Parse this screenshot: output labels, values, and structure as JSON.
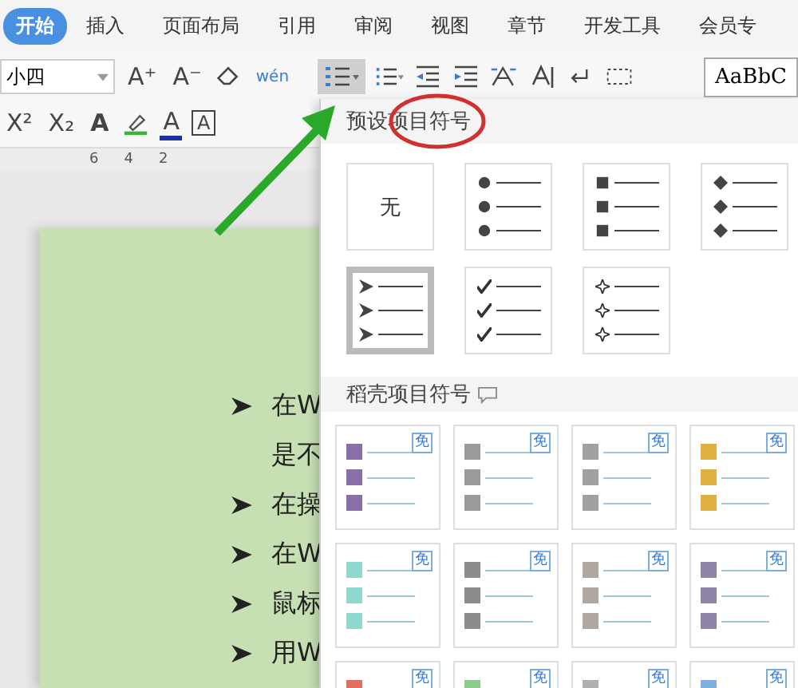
{
  "tabs": [
    {
      "label": "开始",
      "selected": true
    },
    {
      "label": "插入",
      "selected": false
    },
    {
      "label": "页面布局",
      "selected": false
    },
    {
      "label": "引用",
      "selected": false
    },
    {
      "label": "审阅",
      "selected": false
    },
    {
      "label": "视图",
      "selected": false
    },
    {
      "label": "章节",
      "selected": false
    },
    {
      "label": "开发工具",
      "selected": false
    },
    {
      "label": "会员专",
      "selected": false
    }
  ],
  "toolbar": {
    "font_size": "小四",
    "grow_font": "A⁺",
    "shrink_font": "A⁻",
    "pinyin": "wén",
    "superscript": "X²",
    "subscript": "X₂",
    "text_effect": "A",
    "font_color": "A",
    "char_border": "A",
    "style_preview": "AaBbC"
  },
  "ruler": {
    "ticks": [
      "6",
      "4",
      "2"
    ]
  },
  "document": {
    "lines": [
      {
        "text": "在W",
        "bullet": true
      },
      {
        "text": "是不",
        "bullet": false
      },
      {
        "text": "在操",
        "bullet": true
      },
      {
        "text": "在W",
        "bullet": true
      },
      {
        "text": "鼠标",
        "bullet": true
      },
      {
        "text": "用W",
        "bullet": true
      }
    ]
  },
  "bullet_menu": {
    "preset_title": "预设项目符号",
    "presets": [
      {
        "kind": "none",
        "label": "无",
        "selected": false
      },
      {
        "kind": "circle",
        "selected": false
      },
      {
        "kind": "square",
        "selected": false
      },
      {
        "kind": "diamond",
        "selected": false
      },
      {
        "kind": "arrow",
        "selected": true
      },
      {
        "kind": "check",
        "selected": false
      },
      {
        "kind": "star",
        "selected": false
      }
    ],
    "docer_title": "稻壳项目符号",
    "docer_items": [
      {
        "badge": "免",
        "color": "#8a6fa8"
      },
      {
        "badge": "免",
        "color": "#9a9a9a"
      },
      {
        "badge": "免",
        "color": "#a0a0a0"
      },
      {
        "badge": "免",
        "color": "#e0b040"
      },
      {
        "badge": "免",
        "color": "#8fd8d0"
      },
      {
        "badge": "免",
        "color": "#8c8c8c"
      },
      {
        "badge": "免",
        "color": "#b0a8a0"
      },
      {
        "badge": "免",
        "color": "#8e84a8"
      },
      {
        "badge": "免",
        "color": "#e07060"
      },
      {
        "badge": "免",
        "color": "#90c890"
      },
      {
        "badge": "免",
        "color": "#b0b0b0"
      },
      {
        "badge": "免",
        "color": "#80b0e0"
      }
    ]
  }
}
